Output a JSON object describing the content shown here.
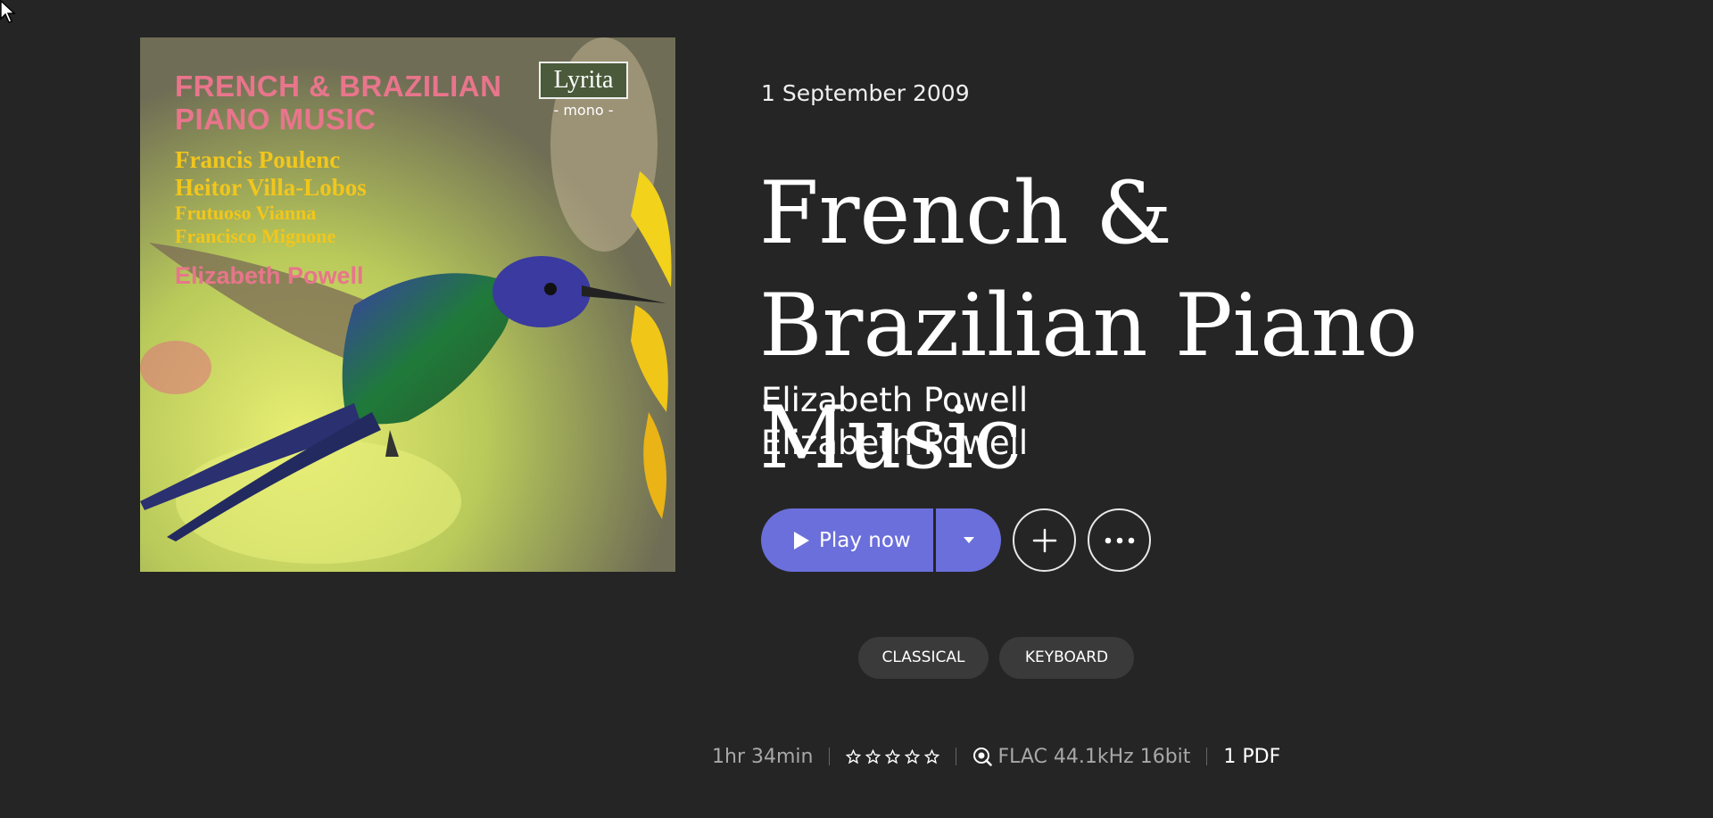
{
  "album": {
    "release_date": "1 September 2009",
    "title_line1": "French &",
    "title_line2": "Brazilian Piano Music",
    "artists": [
      "Elizabeth Powell",
      "Elizabeth Powell"
    ]
  },
  "cover": {
    "title": "FRENCH & BRAZILIAN\nPIANO MUSIC",
    "composers_big": [
      "Francis Poulenc",
      "Heitor Villa-Lobos"
    ],
    "composers_small": [
      "Frutuoso Vianna",
      "Francisco Mignone"
    ],
    "performer": "Elizabeth Powell",
    "label": "Lyrita",
    "label_sub": "- mono -"
  },
  "actions": {
    "play_label": "Play now",
    "add_icon": "plus-icon",
    "more_icon": "more-horizontal-icon"
  },
  "tags": [
    "CLASSICAL",
    "KEYBOARD"
  ],
  "meta": {
    "duration": "1hr 34min",
    "rating_stars": 5,
    "rating_value": 0,
    "quality_icon": "hi-res-search-icon",
    "quality": "FLAC 44.1kHz 16bit",
    "pdf": "1 PDF"
  },
  "colors": {
    "background": "#252525",
    "accent": "#6b6fdb",
    "tag_bg": "#3a3a3a",
    "meta_text": "#a8a8a8"
  }
}
